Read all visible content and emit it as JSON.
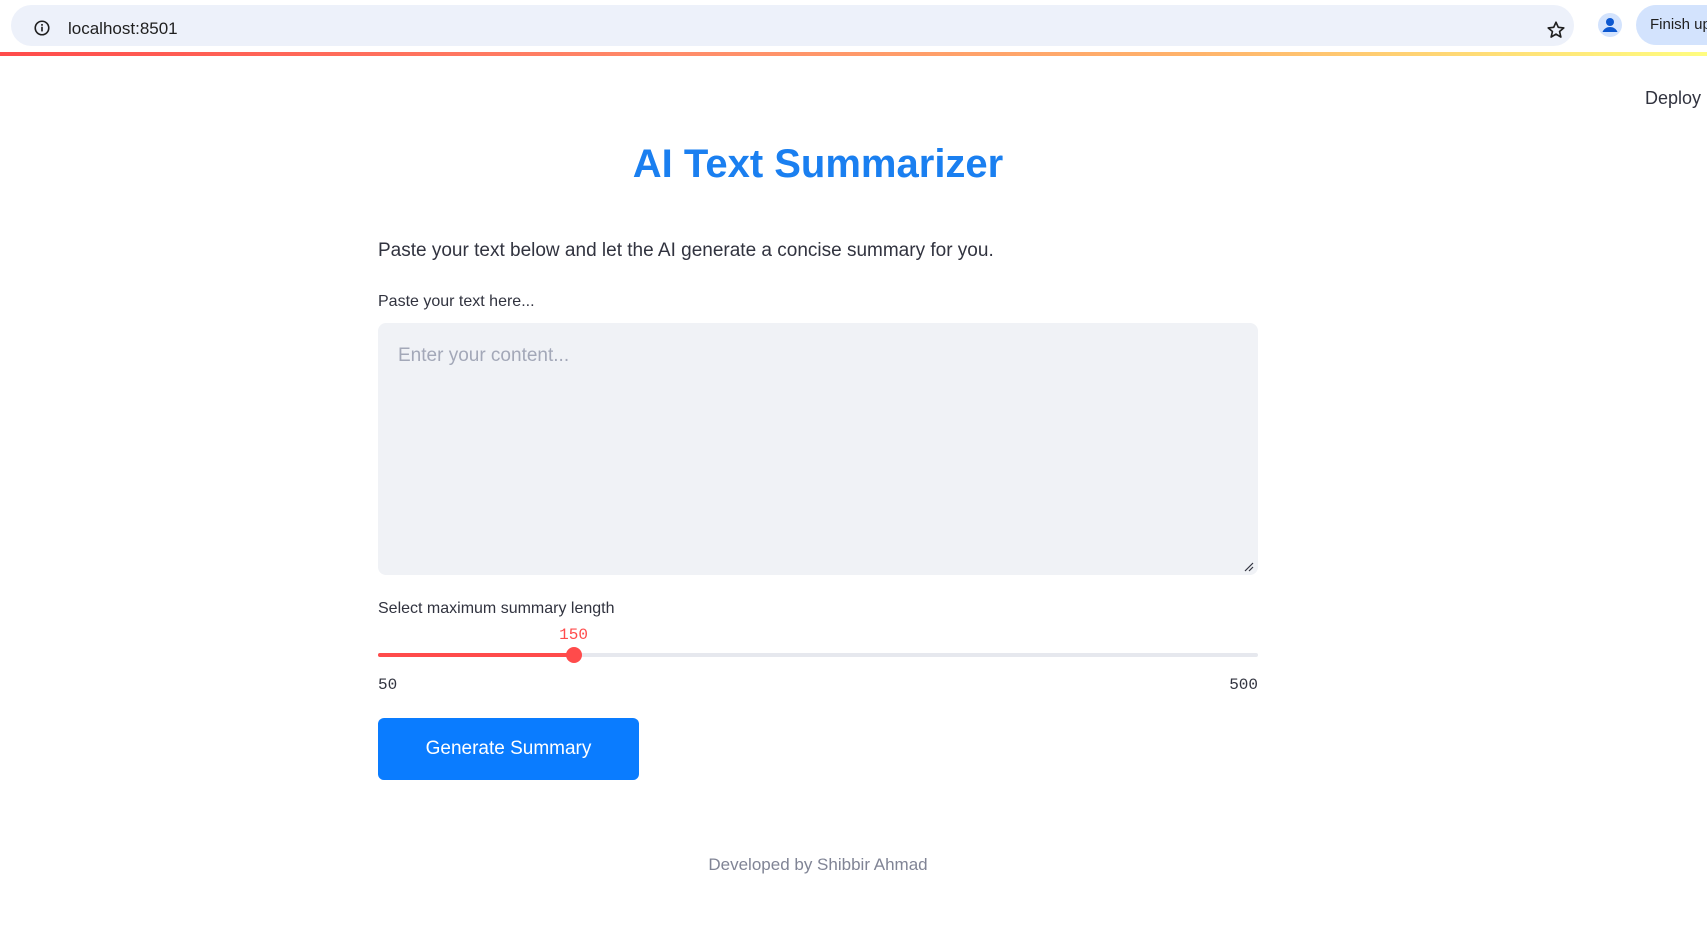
{
  "browser": {
    "url": "localhost:8501",
    "finish_label": "Finish up"
  },
  "toolbar": {
    "deploy_label": "Deploy"
  },
  "main": {
    "title": "AI Text Summarizer",
    "intro": "Paste your text below and let the AI generate a concise summary for you.",
    "textarea_label": "Paste your text here...",
    "textarea_placeholder": "Enter your content...",
    "textarea_value": "",
    "slider": {
      "label": "Select maximum summary length",
      "min": 50,
      "max": 500,
      "value": 150,
      "min_label": "50",
      "max_label": "500",
      "value_label": "150"
    },
    "button_label": "Generate Summary",
    "footer": "Developed by Shibbir Ahmad"
  },
  "colors": {
    "accent": "#ff4b4b",
    "title": "#1a7ff0",
    "button": "#0a7cff"
  },
  "icons": [
    "info-icon",
    "star-icon",
    "profile-icon",
    "resize-grip-icon"
  ]
}
